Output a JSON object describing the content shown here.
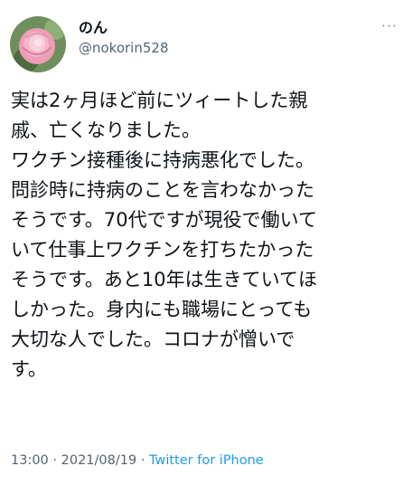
{
  "user": {
    "display_name": "のん",
    "handle": "@nokorin528",
    "avatar_icon": "rose-avatar-icon"
  },
  "more_icon": "more-horizontal-icon",
  "tweet": {
    "lines": [
      "実は2ヶ月ほど前にツィートした親",
      "戚、亡くなりました。",
      "ワクチン接種後に持病悪化でした。",
      "問診時に持病のことを言わなかった",
      "そうです。70代ですが現役で働いて",
      "いて仕事上ワクチンを打ちたかった",
      "そうです。あと10年は生きていてほ",
      "しかった。身内にも職場にとっても",
      "大切な人でした。コロナが憎いで",
      "す。"
    ]
  },
  "meta": {
    "time": "13:00",
    "separator": "·",
    "date": "2021/08/19",
    "source": "Twitter for iPhone"
  },
  "colors": {
    "text": "#0f1419",
    "secondary": "#536471",
    "link": "#1d9bf0"
  }
}
